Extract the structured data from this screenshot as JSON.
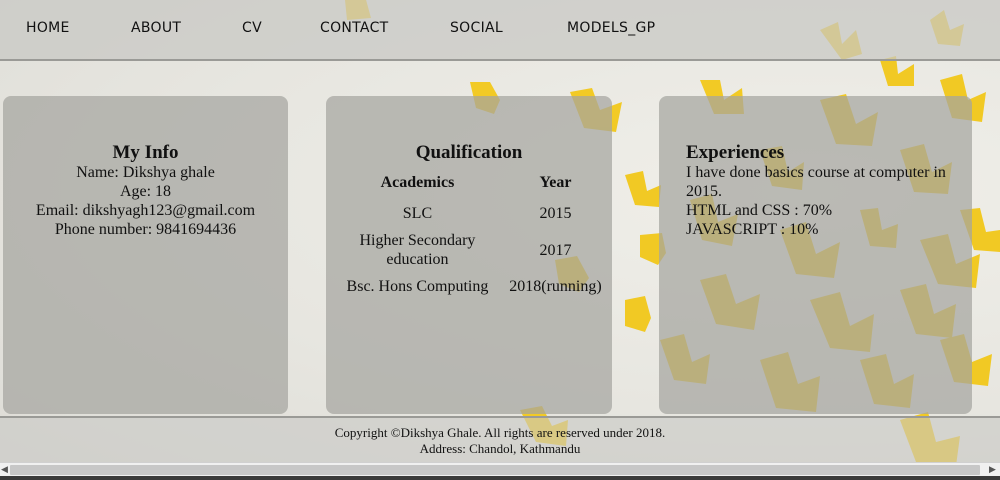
{
  "nav": {
    "items": [
      "HOME",
      "ABOUT",
      "CV",
      "CONTACT",
      "SOCIAL",
      "MODELS_GP"
    ]
  },
  "info": {
    "title": "My Info",
    "name": "Name: Dikshya ghale",
    "age": "Age: 18",
    "email": "Email: dikshyagh123@gmail.com",
    "phone": "Phone number: 9841694436"
  },
  "qualification": {
    "title": "Qualification",
    "headers": [
      "Academics",
      "Year"
    ],
    "rows": [
      [
        "SLC",
        "2015"
      ],
      [
        "Higher Secondary education",
        "2017"
      ],
      [
        "Bsc. Hons Computing",
        "2018(running)"
      ]
    ]
  },
  "experiences": {
    "title": "Experiences",
    "line1": "I have done basics course at computer in 2015.",
    "line2": "HTML and CSS : 70%",
    "line3": "JAVASCRIPT : 10%"
  },
  "footer": {
    "copyright": "Copyright ©Dikshya Ghale. All rights are reserved under 2018.",
    "address": "Address: Chandol, Kathmandu"
  },
  "colors": {
    "butterfly": "#f2c81a",
    "card": "#a5a5a0",
    "nav": "#c8c8c4"
  }
}
